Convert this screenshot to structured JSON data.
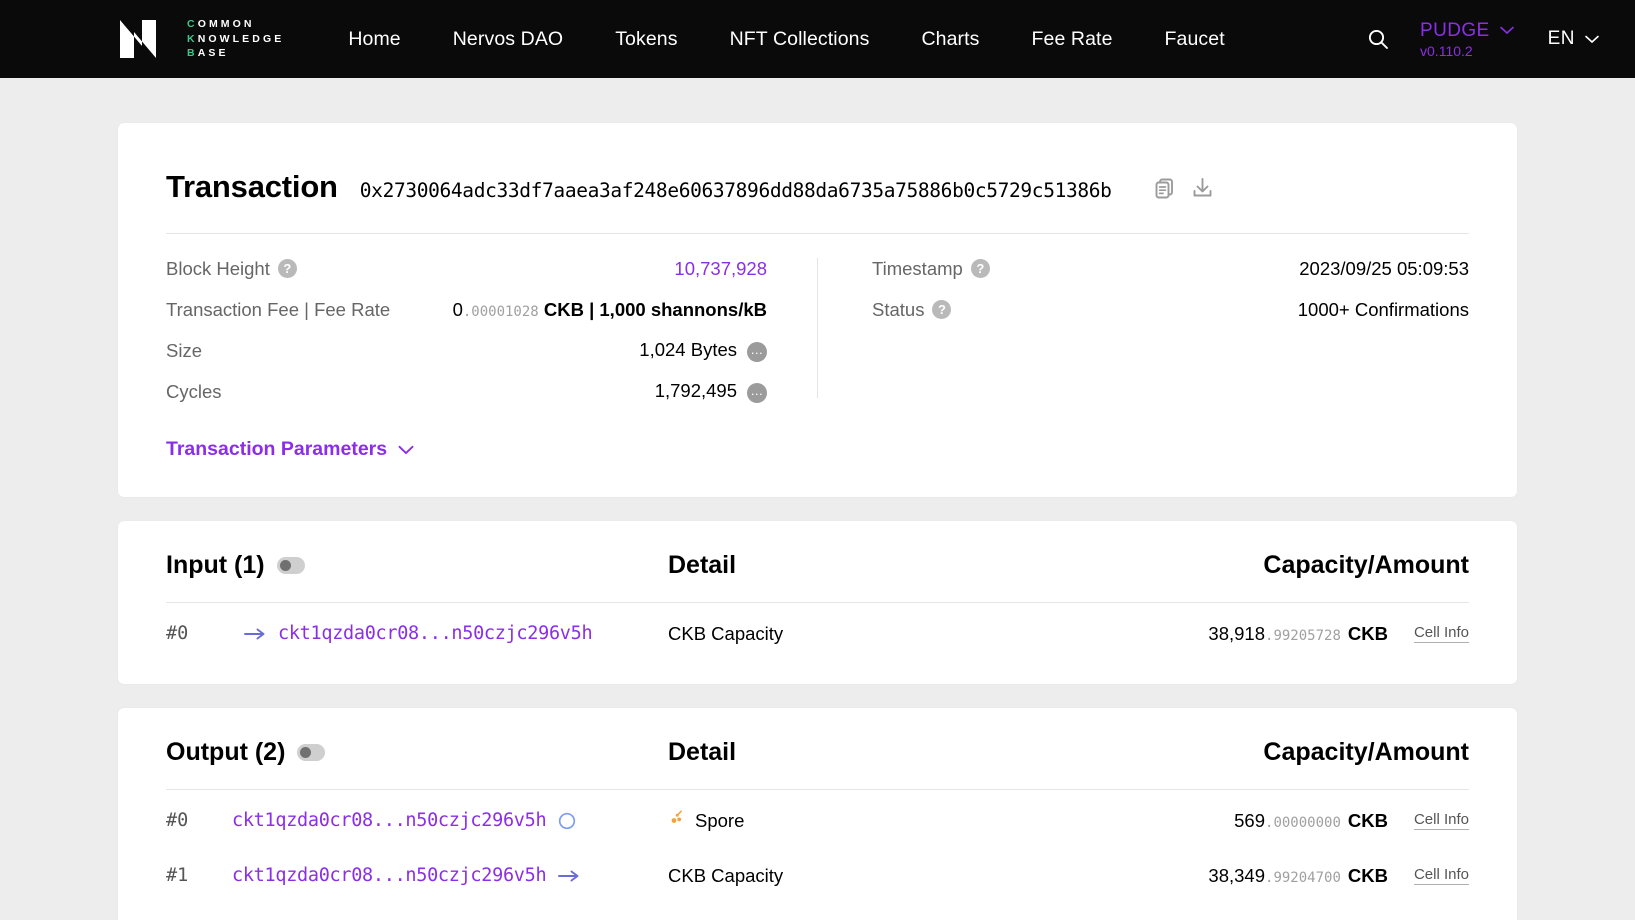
{
  "header": {
    "logo": {
      "line1": "COMMON",
      "line2": "KNOWLEDGE",
      "line3": "BASE",
      "accent_color": "#3cc68a"
    },
    "nav": [
      {
        "label": "Home"
      },
      {
        "label": "Nervos DAO"
      },
      {
        "label": "Tokens"
      },
      {
        "label": "NFT Collections"
      },
      {
        "label": "Charts"
      },
      {
        "label": "Fee Rate"
      },
      {
        "label": "Faucet"
      }
    ],
    "search_icon": "search-icon",
    "chain": {
      "name": "PUDGE",
      "version": "v0.110.2",
      "color": "#8b2ee8"
    },
    "language": {
      "label": "EN"
    }
  },
  "transaction": {
    "title": "Transaction",
    "hash": "0x2730064adc33df7aaea3af248e60637896dd88da6735a75886b0c5729c51386b",
    "copy_icon": "copy-icon",
    "download_icon": "download-icon",
    "fields_left": [
      {
        "label": "Block Height",
        "help": "?",
        "value": "10,737,928",
        "link": true
      },
      {
        "label": "Transaction Fee | Fee Rate",
        "help": "",
        "value_int": "0",
        "value_dec": ".00001028",
        "value_unit": "CKB | 1,000 shannons/kB"
      },
      {
        "label": "Size",
        "help": "",
        "value": "1,024 Bytes",
        "dots": "…"
      },
      {
        "label": "Cycles",
        "help": "",
        "value": "1,792,495",
        "dots": "…"
      }
    ],
    "fields_right": [
      {
        "label": "Timestamp",
        "help": "?",
        "value": "2023/09/25 05:09:53"
      },
      {
        "label": "Status",
        "help": "?",
        "value": "1000+ Confirmations"
      }
    ],
    "parameters_label": "Transaction Parameters"
  },
  "input_section": {
    "title": "Input (1)",
    "col_detail": "Detail",
    "col_capacity": "Capacity/Amount",
    "rows": [
      {
        "index": "#0",
        "lead_icon": "arrow-right-icon",
        "address": "ckt1qzda0cr08...n50czjc296v5h",
        "trail_icon": "",
        "detail_icon": "",
        "detail": "CKB Capacity",
        "amount_int": "38,918",
        "amount_dec": ".99205728",
        "amount_unit": "CKB",
        "cell_info": "Cell Info"
      }
    ]
  },
  "output_section": {
    "title": "Output (2)",
    "col_detail": "Detail",
    "col_capacity": "Capacity/Amount",
    "rows": [
      {
        "index": "#0",
        "lead_icon": "",
        "address": "ckt1qzda0cr08...n50czjc296v5h",
        "trail_icon": "circle-icon",
        "detail_icon": "spore-icon",
        "detail": "Spore",
        "amount_int": "569",
        "amount_dec": ".00000000",
        "amount_unit": "CKB",
        "cell_info": "Cell Info"
      },
      {
        "index": "#1",
        "lead_icon": "",
        "address": "ckt1qzda0cr08...n50czjc296v5h",
        "trail_icon": "arrow-right-icon",
        "detail_icon": "",
        "detail": "CKB Capacity",
        "amount_int": "38,349",
        "amount_dec": ".99204700",
        "amount_unit": "CKB",
        "cell_info": "Cell Info"
      }
    ]
  }
}
